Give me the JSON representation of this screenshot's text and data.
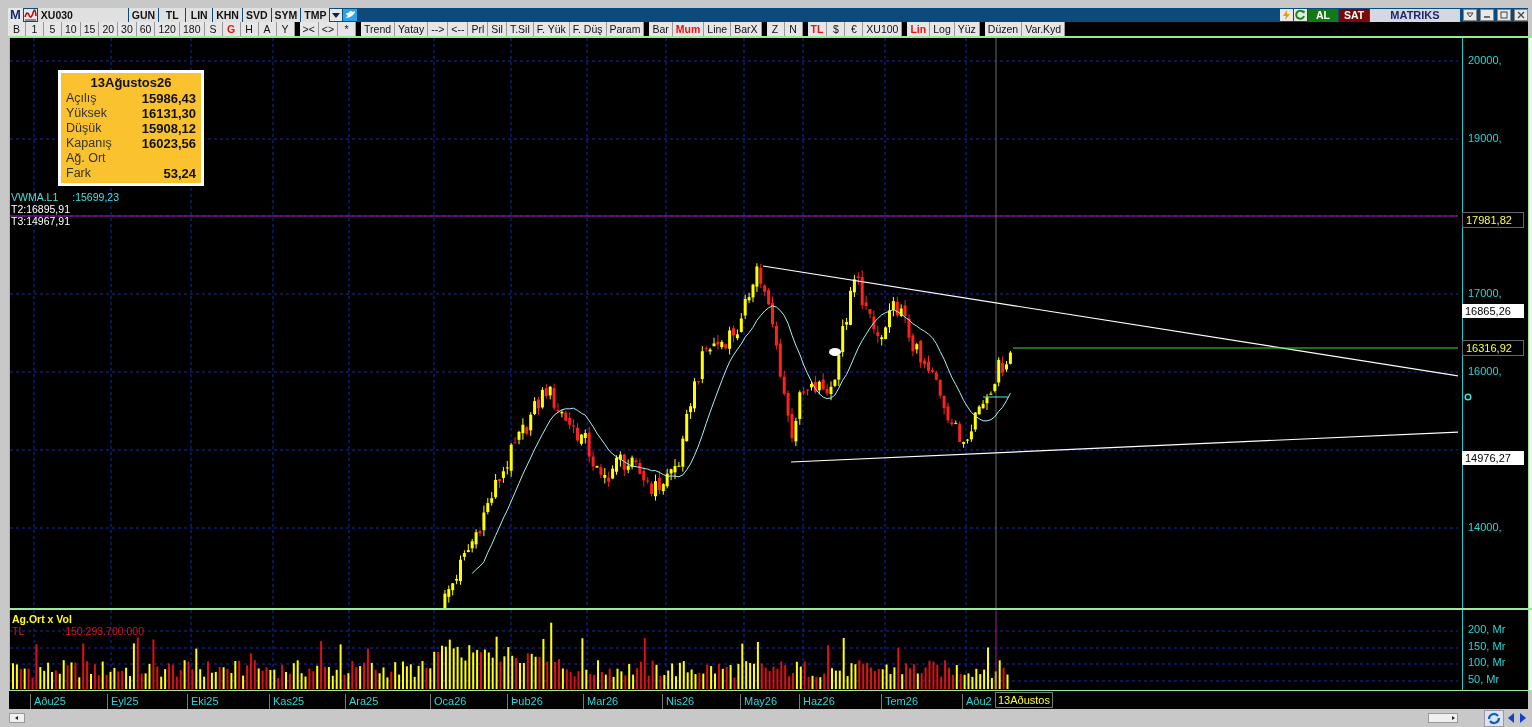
{
  "title_bar": {
    "logo": "M",
    "symbol": "XU030",
    "items": [
      "GUN",
      "TL",
      "LIN",
      "KHN",
      "SVD",
      "SYM",
      "TMP"
    ],
    "buy": "AL",
    "sell": "SAT",
    "brand": "MATRIKS"
  },
  "toolbar": {
    "groups": [
      {
        "items": [
          {
            "label": "B",
            "selected": false
          },
          {
            "label": "1",
            "selected": false
          },
          {
            "label": "5",
            "selected": false
          },
          {
            "label": "10",
            "selected": false
          },
          {
            "label": "15",
            "selected": false
          },
          {
            "label": "20",
            "selected": false
          },
          {
            "label": "30",
            "selected": false
          },
          {
            "label": "60",
            "selected": false
          },
          {
            "label": "120",
            "selected": false
          },
          {
            "label": "180",
            "selected": false
          },
          {
            "label": "S",
            "selected": false
          },
          {
            "label": "G",
            "selected": true
          },
          {
            "label": "H",
            "selected": false
          },
          {
            "label": "A",
            "selected": false
          },
          {
            "label": "Y",
            "selected": false
          }
        ]
      },
      {
        "items": [
          {
            "label": "><",
            "selected": false
          },
          {
            "label": "<>",
            "selected": false
          },
          {
            "label": "*",
            "selected": false
          }
        ]
      },
      {
        "items": [
          {
            "label": "Trend",
            "selected": false
          },
          {
            "label": "Yatay",
            "selected": false
          },
          {
            "label": "-->",
            "selected": false
          },
          {
            "label": "<--",
            "selected": false
          },
          {
            "label": "Prl",
            "selected": false
          },
          {
            "label": "Sil",
            "selected": false
          },
          {
            "label": "T.Sil",
            "selected": false
          },
          {
            "label": "F. Yük",
            "selected": false
          },
          {
            "label": "F. Düş",
            "selected": false
          },
          {
            "label": "Param",
            "selected": false
          }
        ]
      },
      {
        "items": [
          {
            "label": "Bar",
            "selected": false
          },
          {
            "label": "Mum",
            "selected": true
          },
          {
            "label": "Line",
            "selected": false
          },
          {
            "label": "BarX",
            "selected": false
          }
        ]
      },
      {
        "items": [
          {
            "label": "Z",
            "selected": false
          },
          {
            "label": "N",
            "selected": false
          }
        ]
      },
      {
        "items": [
          {
            "label": "TL",
            "selected": true
          },
          {
            "label": "$",
            "selected": false
          },
          {
            "label": "€",
            "selected": false
          },
          {
            "label": "XU100",
            "selected": false
          }
        ]
      },
      {
        "items": [
          {
            "label": "Lin",
            "selected": true
          },
          {
            "label": "Log",
            "selected": false
          },
          {
            "label": "Yüz",
            "selected": false
          }
        ]
      },
      {
        "items": [
          {
            "label": "Düzen",
            "selected": false
          },
          {
            "label": "Var.Kyd",
            "selected": false
          }
        ]
      }
    ]
  },
  "info_box": {
    "date": "13Ağustos26",
    "rows": [
      {
        "label": "Açılış",
        "value": "15986,43"
      },
      {
        "label": "Yüksek",
        "value": "16131,30"
      },
      {
        "label": "Düşük",
        "value": "15908,12"
      },
      {
        "label": "Kapanış",
        "value": "16023,56"
      },
      {
        "label": "Ağ. Ort"
      },
      {
        "label": "Fark",
        "value": "53,24"
      }
    ]
  },
  "indicators": [
    {
      "text": "VWMA.L1",
      "value": ":15699,23"
    },
    {
      "text": "T2:16895,91"
    },
    {
      "text": "T3:14967,91"
    }
  ],
  "price_axis": {
    "ticks": [
      "20000,",
      "19000,",
      "17000,",
      "16000,",
      "14000,"
    ]
  },
  "price_tags": [
    {
      "kind": "level",
      "text": "17981,82"
    },
    {
      "kind": "boxed",
      "text": "16865,26"
    },
    {
      "kind": "level",
      "text": "16316,92"
    },
    {
      "kind": "boxed",
      "text": "14976,27"
    }
  ],
  "volume_panel": {
    "title": "Ag.Ort x Vol",
    "currency": "TL",
    "value": ":150.293.700.000",
    "axis": [
      "200, Mr",
      "150, Mr",
      "100, Mr",
      "50, Mr"
    ]
  },
  "date_axis": {
    "labels": [
      "Aðu25",
      "Eyl25",
      "Eki25",
      "Kas25",
      "Ara25",
      "Oca26",
      "Þub26",
      "Mar26",
      "Nis26",
      "May26",
      "Haz26",
      "Tem26",
      "Aðu2"
    ],
    "cursor_label": "13Aðustos"
  }
}
